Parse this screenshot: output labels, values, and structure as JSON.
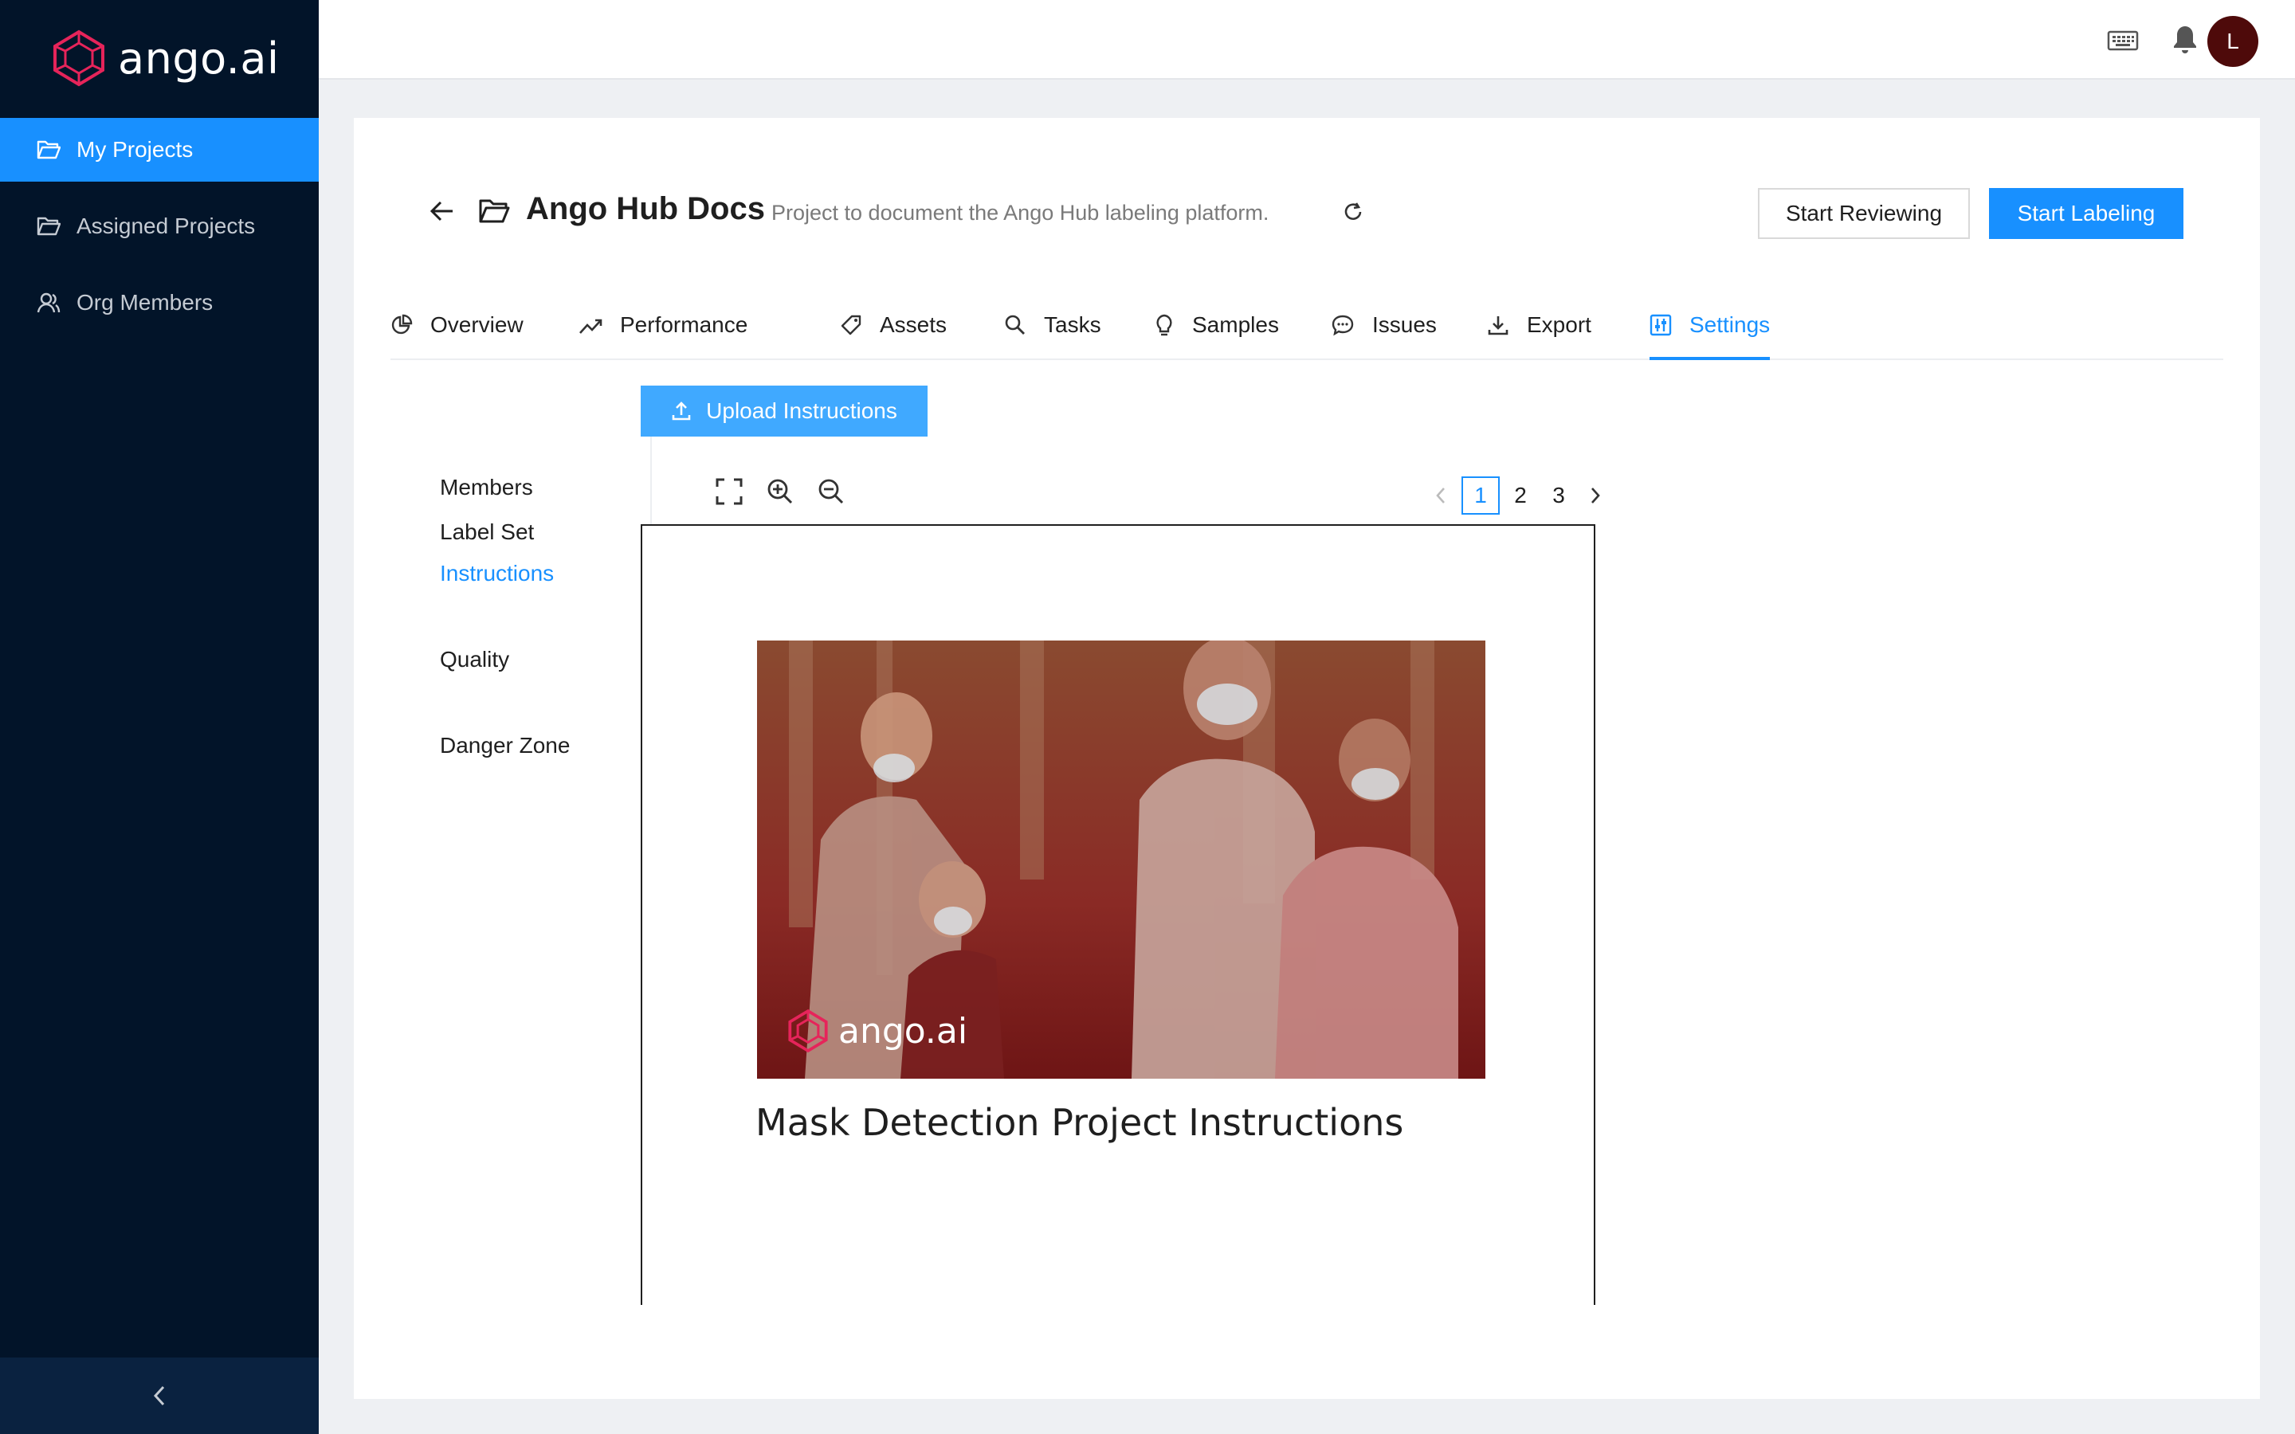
{
  "brand": {
    "name": "ango.ai",
    "accent": "#e6245a"
  },
  "sidebar": {
    "items": [
      {
        "label": "My Projects",
        "icon": "folder-open-icon",
        "active": true
      },
      {
        "label": "Assigned Projects",
        "icon": "folder-open-icon",
        "active": false
      },
      {
        "label": "Org Members",
        "icon": "users-icon",
        "active": false
      }
    ],
    "collapse_icon": "chevron-left-icon"
  },
  "topbar": {
    "icons": [
      "keyboard-icon",
      "bell-icon"
    ],
    "avatar_initial": "L"
  },
  "project": {
    "title": "Ango Hub Docs",
    "description": "Project to document the Ango Hub labeling platform.",
    "start_reviewing": "Start Reviewing",
    "start_labeling": "Start Labeling"
  },
  "tabs": [
    {
      "label": "Overview",
      "icon": "pie-chart-icon"
    },
    {
      "label": "Performance",
      "icon": "trend-line-icon"
    },
    {
      "label": "Assets",
      "icon": "tag-icon"
    },
    {
      "label": "Tasks",
      "icon": "search-icon"
    },
    {
      "label": "Samples",
      "icon": "bulb-icon"
    },
    {
      "label": "Issues",
      "icon": "chat-icon"
    },
    {
      "label": "Export",
      "icon": "download-icon"
    },
    {
      "label": "Settings",
      "icon": "sliders-icon",
      "active": true
    }
  ],
  "settings_nav": {
    "items": [
      "Label Set",
      "Members",
      "Instructions",
      "Quality",
      "Danger Zone"
    ],
    "active": "Instructions"
  },
  "instructions": {
    "upload_label": "Upload Instructions",
    "pages": [
      "1",
      "2",
      "3"
    ],
    "current_page": "1",
    "cover_logo_text": "ango.ai",
    "doc_heading": "Mask Detection Project Instructions"
  },
  "colors": {
    "primary": "#1890ff",
    "sidebar_bg": "#021429",
    "avatar_bg": "#4e0a0a"
  }
}
